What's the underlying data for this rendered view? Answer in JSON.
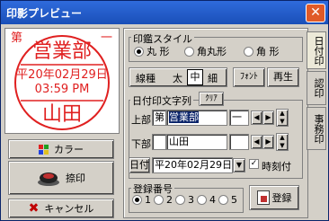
{
  "window": {
    "title": "印影プレビュー",
    "close_label": "✕"
  },
  "stamp": {
    "top_left": "第",
    "top_right": "一",
    "top_text": "営業部",
    "date": "平20年02月29日",
    "time": "03:59 PM",
    "bottom_text": "山田",
    "color": "#e02020"
  },
  "buttons": {
    "color": "カラー",
    "stamp": "捺印",
    "cancel": "キャンセル",
    "font": "ﾌｫﾝﾄ",
    "replay": "再生",
    "clear": "ｸﾘｱ",
    "register": "登録"
  },
  "shape": {
    "label": "印鑑スタイル",
    "options": [
      "丸 形",
      "角丸形",
      "角 形"
    ],
    "selected": 0
  },
  "line_type": {
    "label": "線種",
    "options": [
      "太",
      "中",
      "細"
    ],
    "selected": 1
  },
  "date_text": {
    "label": "日付印文字列",
    "upper_label": "上部",
    "upper_prefix": "第",
    "upper_value": "営業部",
    "upper_suffix": "一",
    "lower_label": "下部",
    "lower_value": "山田",
    "date_button": "日付",
    "date_value": "平20年02月29日",
    "time_check_label": "時刻付"
  },
  "reg": {
    "label": "登録番号",
    "options": [
      "1",
      "2",
      "3",
      "4",
      "5"
    ],
    "selected": 0
  },
  "tabs": [
    "日付印",
    "認印",
    "事務印"
  ]
}
